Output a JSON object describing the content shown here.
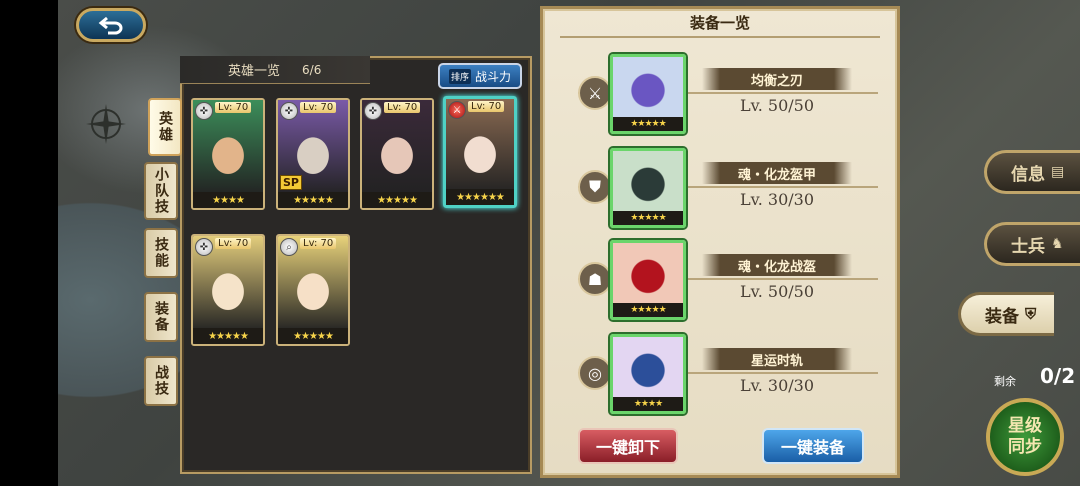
{
  "hero_panel": {
    "title": "英雄一览",
    "count": "6/6",
    "sort_tag": "排序",
    "sort_label": "战斗力"
  },
  "side_tabs": [
    {
      "label": "英雄",
      "active": true
    },
    {
      "label": "小队技",
      "active": false
    },
    {
      "label": "技能",
      "active": false
    },
    {
      "label": "装备",
      "active": false
    },
    {
      "label": "战技",
      "active": false
    }
  ],
  "heroes": [
    {
      "lv": "Lv: 70",
      "stars": "★★★★",
      "class_icon": "crosshair-icon",
      "palette": [
        "#3c8e5a",
        "#e2b48a"
      ],
      "selected": false,
      "sp": ""
    },
    {
      "lv": "Lv: 70",
      "stars": "★★★★★",
      "class_icon": "mage-icon",
      "palette": [
        "#7a5aa8",
        "#d9cfc3"
      ],
      "selected": false,
      "sp": "SP"
    },
    {
      "lv": "Lv: 70",
      "stars": "★★★★★",
      "class_icon": "crosshair-icon",
      "palette": [
        "#3b2a3a",
        "#e6c7b8"
      ],
      "selected": false,
      "sp": ""
    },
    {
      "lv": "Lv: 70",
      "stars": "★★★★★★",
      "class_icon": "sword-icon",
      "palette": [
        "#8a6a52",
        "#f1ddd0"
      ],
      "selected": true,
      "sp": ""
    },
    {
      "lv": "Lv: 70",
      "stars": "★★★★★",
      "class_icon": "crosshair-icon",
      "palette": [
        "#e3cd7c",
        "#f5e3c9"
      ],
      "selected": false,
      "sp": ""
    },
    {
      "lv": "Lv: 70",
      "stars": "★★★★★",
      "class_icon": "search-icon",
      "palette": [
        "#e8d27a",
        "#f6e0c7"
      ],
      "selected": false,
      "sp": ""
    }
  ],
  "equipment": {
    "title": "装备一览",
    "items": [
      {
        "name": "均衡之刃",
        "lv": "Lv. 50/50",
        "slot_icon": "sword-slot-icon",
        "stars": "★★★★★",
        "palette": [
          "#c9d7ef",
          "#6a56c2"
        ]
      },
      {
        "name": "魂・化龙盔甲",
        "lv": "Lv. 30/30",
        "slot_icon": "armor-slot-icon",
        "stars": "★★★★★",
        "palette": [
          "#c9dfc9",
          "#2b3b38"
        ]
      },
      {
        "name": "魂・化龙战盔",
        "lv": "Lv. 50/50",
        "slot_icon": "helmet-slot-icon",
        "stars": "★★★★★",
        "palette": [
          "#f1c8b7",
          "#b3131e"
        ]
      },
      {
        "name": "星运时轨",
        "lv": "Lv. 30/30",
        "slot_icon": "accessory-slot-icon",
        "stars": "★★★★",
        "palette": [
          "#e3d6f2",
          "#2c4f9a"
        ]
      }
    ],
    "unload_all": "一键卸下",
    "equip_all": "一键装备"
  },
  "right_menu": {
    "info": "信息",
    "soldier": "士兵",
    "equip": "装备",
    "remain_label": "剩余",
    "remain_value": "0/2",
    "star_sync": "星级同步"
  }
}
